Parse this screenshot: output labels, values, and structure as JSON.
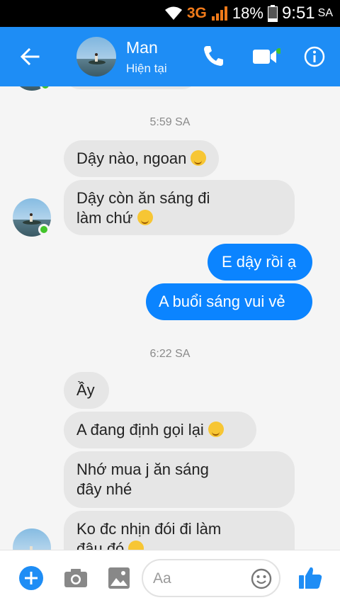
{
  "status_bar": {
    "network": "3G",
    "battery": "18%",
    "time": "9:51",
    "ampm": "SA"
  },
  "header": {
    "contact_name": "Man",
    "presence": "Hiện tại"
  },
  "chat": {
    "sep1": "5:59 SA",
    "m1": "Dậy nào, ngoan",
    "m2_line1": "Dậy còn ăn sáng đi",
    "m2_line2": "làm chứ",
    "m3": "E dậy rồi ạ",
    "m4": "A buổi sáng vui vẻ",
    "sep2": "6:22 SA",
    "m5": "Ầy",
    "m6": "A đang định gọi lại",
    "m7_line1": "Nhớ mua j ăn sáng",
    "m7_line2": "đây nhé",
    "m8_line1": "Ko đc nhịn đói đi làm",
    "m8_line2": "đâu đó"
  },
  "composer": {
    "placeholder": "Aa"
  },
  "colors": {
    "brand": "#1e8df5",
    "outgoing_bubble": "#0b84ff",
    "incoming_bubble": "#e6e6e6",
    "online": "#42c42a"
  }
}
